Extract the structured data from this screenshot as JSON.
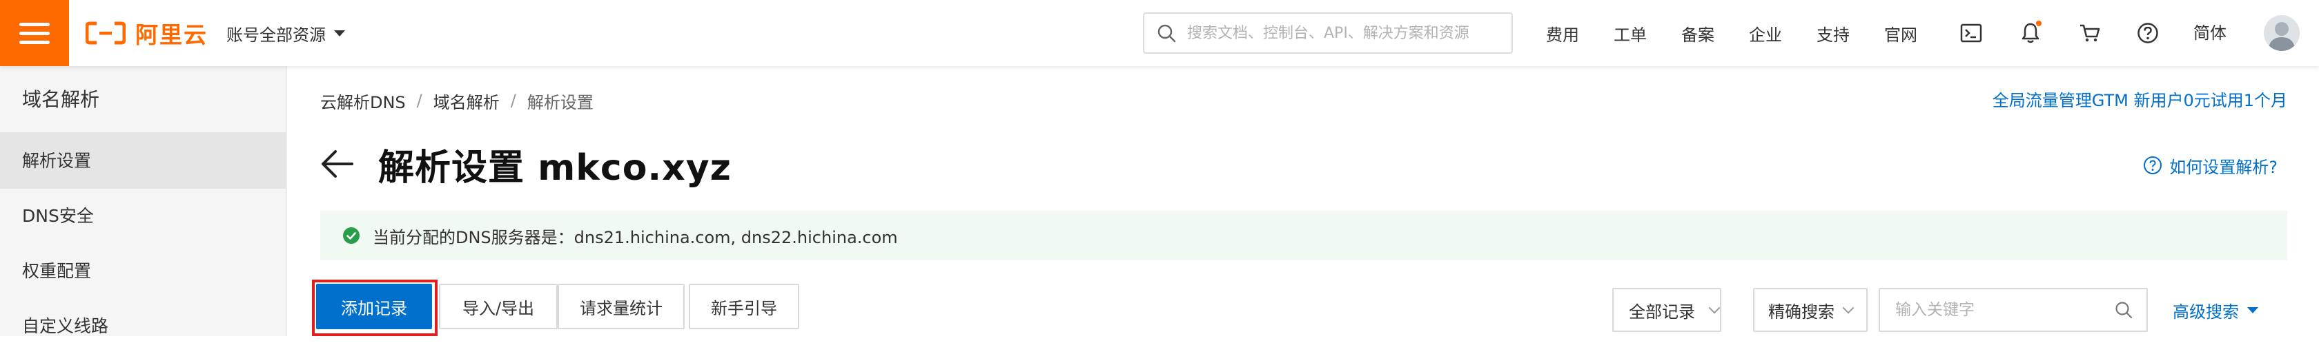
{
  "header": {
    "brand": "阿里云",
    "account_scope": "账号全部资源",
    "search_placeholder": "搜索文档、控制台、API、解决方案和资源",
    "links": [
      "费用",
      "工单",
      "备案",
      "企业",
      "支持",
      "官网"
    ],
    "language": "简体",
    "brand_color": "#ff6a00"
  },
  "sidebar": {
    "title": "域名解析",
    "items": [
      {
        "label": "解析设置",
        "active": true
      },
      {
        "label": "DNS安全",
        "active": false
      },
      {
        "label": "权重配置",
        "active": false
      },
      {
        "label": "自定义线路",
        "active": false
      }
    ]
  },
  "breadcrumb": [
    "云解析DNS",
    "域名解析",
    "解析设置"
  ],
  "promo_link": "全局流量管理GTM 新用户0元试用1个月",
  "page": {
    "title": "解析设置 mkco.xyz",
    "help_link": "如何设置解析?"
  },
  "notice": {
    "text": "当前分配的DNS服务器是：dns21.hichina.com, dns22.hichina.com",
    "status_color": "#2a9d4a"
  },
  "toolbar": {
    "add_record": "添加记录",
    "import_export": "导入/导出",
    "request_stats": "请求量统计",
    "guide": "新手引导"
  },
  "filters": {
    "record_type": "全部记录",
    "search_mode": "精确搜索",
    "keyword_placeholder": "输入关键字",
    "advanced": "高级搜索"
  },
  "colors": {
    "primary": "#0070cc",
    "highlight": "#e02020"
  }
}
